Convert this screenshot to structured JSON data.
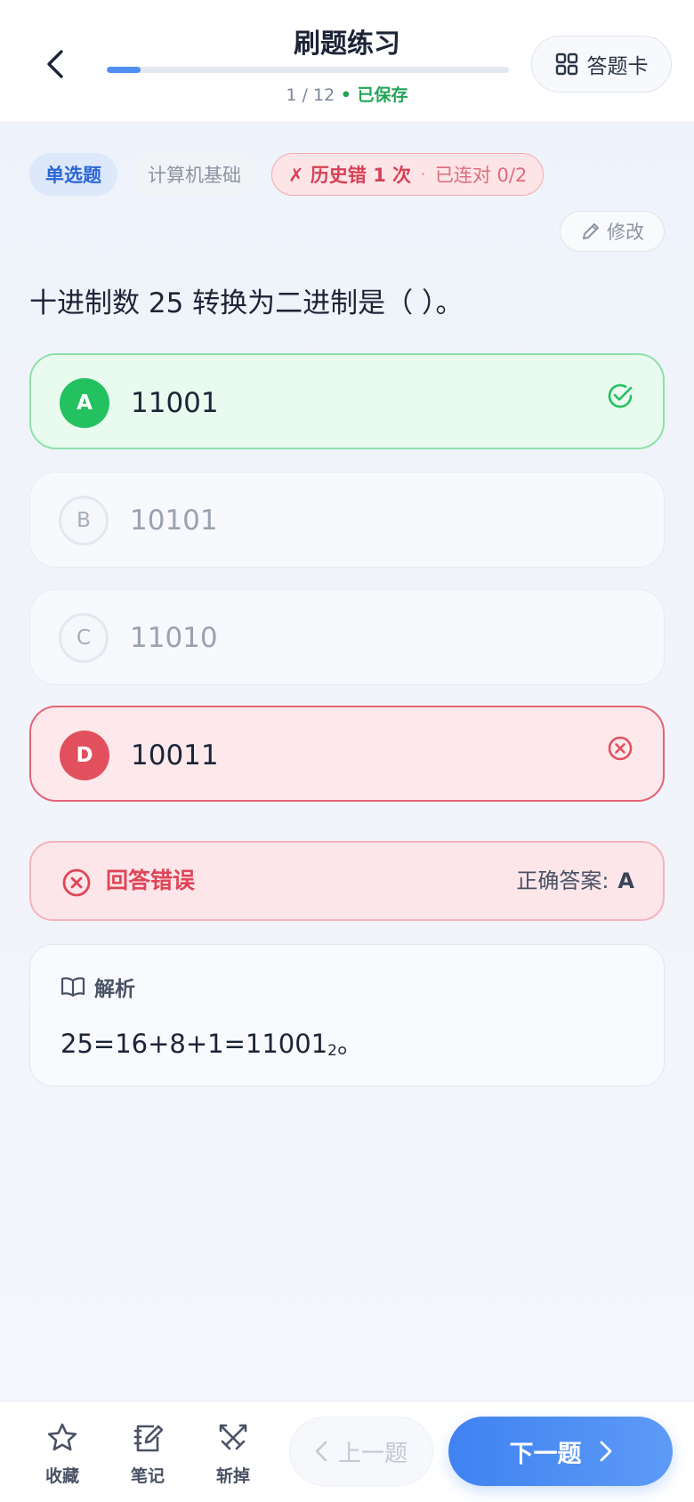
{
  "header": {
    "title": "刷题练习",
    "progress_current": "1",
    "progress_separator": " / ",
    "progress_total": "12",
    "progress_fraction": 0.083,
    "saved_label": " • 已保存",
    "answer_card_label": "答题卡"
  },
  "tags": {
    "type": "单选题",
    "subject": "计算机基础",
    "history_wrong": "✗ 历史错 1 次",
    "history_dot": "·",
    "history_streak": "已连对 0/2"
  },
  "edit_label": "修改",
  "question": "十进制数 25 转换为二进制是（ ）。",
  "options": [
    {
      "letter": "A",
      "text": "11001",
      "state": "correct"
    },
    {
      "letter": "B",
      "text": "10101",
      "state": "normal"
    },
    {
      "letter": "C",
      "text": "11010",
      "state": "normal"
    },
    {
      "letter": "D",
      "text": "10011",
      "state": "wrong"
    }
  ],
  "result": {
    "status": "回答错误",
    "answer_label": "正确答案:",
    "answer_value": "A"
  },
  "analysis": {
    "title": "解析",
    "body_main": "25=16+8+1=11001",
    "body_sub": "2",
    "body_end": "。"
  },
  "toolbar": {
    "favorite": "收藏",
    "notes": "笔记",
    "remove": "斩掉",
    "prev": "上一题",
    "next": "下一题"
  },
  "colors": {
    "accent": "#4f8ef2",
    "correct": "#23c160",
    "wrong": "#e2505e",
    "saved": "#21a458"
  }
}
